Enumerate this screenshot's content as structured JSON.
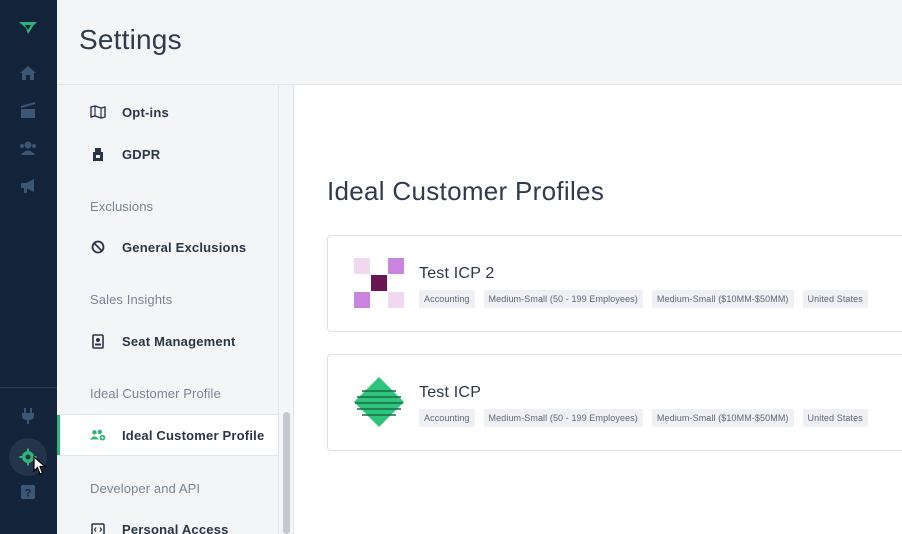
{
  "header": {
    "title": "Settings"
  },
  "rail": {
    "icons": [
      "logo-icon",
      "home-icon",
      "chart-icon",
      "users-icon",
      "megaphone-icon",
      "plug-icon",
      "settings-gear-icon",
      "help-icon"
    ],
    "accent": "#2fb57a"
  },
  "nav": {
    "items_top": [
      {
        "label": "Opt-ins",
        "icon": "map-icon"
      },
      {
        "label": "GDPR",
        "icon": "shield-icon"
      }
    ],
    "sections": [
      {
        "title": "Exclusions",
        "items": [
          {
            "label": "General Exclusions",
            "icon": "ban-icon"
          }
        ]
      },
      {
        "title": "Sales Insights",
        "items": [
          {
            "label": "Seat Management",
            "icon": "id-badge-icon"
          }
        ]
      },
      {
        "title": "Ideal Customer Profile",
        "items": [
          {
            "label": "Ideal Customer Profile",
            "icon": "users-gear-icon",
            "active": true
          }
        ]
      },
      {
        "title": "Developer and API",
        "items": [
          {
            "label": "Personal Access",
            "icon": "code-icon"
          }
        ]
      }
    ]
  },
  "main": {
    "title": "Ideal Customer Profiles",
    "profiles": [
      {
        "name": "Test ICP 2",
        "tags": [
          "Accounting",
          "Medium-Small (50 - 199 Employees)",
          "Medium-Small ($10MM-$50MM)",
          "United States"
        ],
        "logo": "purple-checker-logo"
      },
      {
        "name": "Test ICP",
        "tags": [
          "Accounting",
          "Medium-Small (50 - 199 Employees)",
          "Medium-Small ($10MM-$50MM)",
          "United States"
        ],
        "logo": "green-diamond-logo"
      }
    ]
  }
}
